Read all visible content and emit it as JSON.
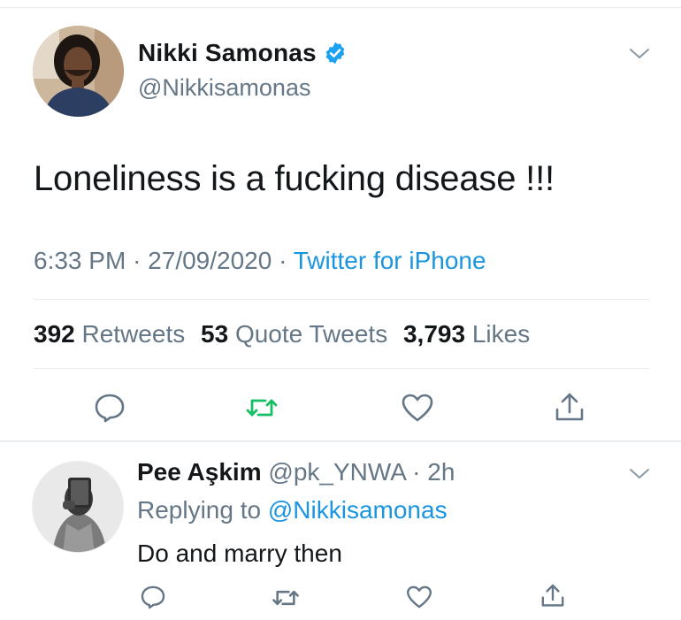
{
  "tweet": {
    "author_name": "Nikki Samonas",
    "author_handle": "@Nikkisamonas",
    "verified": true,
    "text": "Loneliness is a fucking disease !!!",
    "time": "6:33 PM",
    "date": "27/09/2020",
    "source": "Twitter for iPhone",
    "stats": {
      "retweets_count": "392",
      "retweets_label": "Retweets",
      "quotes_count": "53",
      "quotes_label": "Quote Tweets",
      "likes_count": "3,793",
      "likes_label": "Likes"
    }
  },
  "reply": {
    "author_name": "Pee Aşkim",
    "author_handle": "@pk_YNWA",
    "age": "2h",
    "replying_prefix": "Replying to",
    "replying_to": "@Nikkisamonas",
    "text": "Do and marry then"
  },
  "colors": {
    "accent": "#1da1f2",
    "link": "#1b95e0",
    "retweet_green": "#17bf63",
    "muted": "#657786",
    "divider": "#e6ecf0"
  },
  "icons": [
    "reply-icon",
    "retweet-icon",
    "like-icon",
    "share-icon",
    "verified-badge-icon",
    "chevron-down-icon"
  ]
}
